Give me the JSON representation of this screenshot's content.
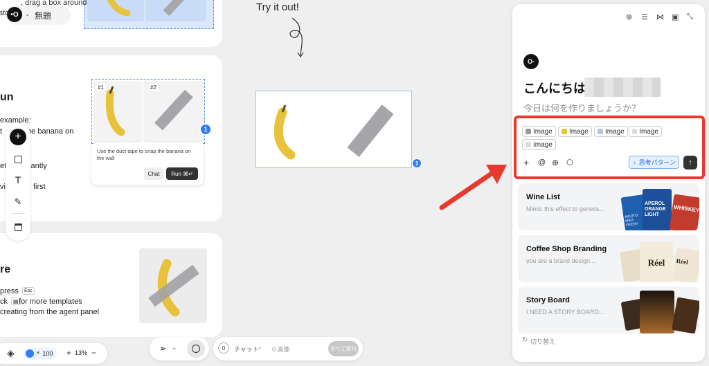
{
  "top_bar": {
    "hint_text": ", drag a box around",
    "hint_text2": "ato",
    "project_title": "無題"
  },
  "canvas": {
    "try_it_out": "Try it out!",
    "mid_card": {
      "heading": "un",
      "line1": "example:",
      "line2": "t",
      "line2b": "the banana on",
      "line3": "et",
      "line3b": "stantly",
      "line4": "vit",
      "line4b": "first",
      "image_labels": [
        "#1",
        "#2"
      ],
      "badge": "1",
      "prompt_text": "Use the duct tape to snap the banana on the wall",
      "chat_button": "Chat",
      "run_button": "Run ⌘↵"
    },
    "bot_card": {
      "heading": "re",
      "line1": "press",
      "esc": "Esc",
      "line2": "ck",
      "line2b": "for more templates",
      "line3": "creating from the agent panel"
    },
    "center_badge": "1"
  },
  "bottom_left": {
    "credits": "100",
    "zoom": "13%"
  },
  "bottom_center": {
    "count": "0",
    "chat_label": "チャット",
    "images_label": "0 画像",
    "run_all": "すべて実行"
  },
  "panel": {
    "greeting": "こんにちは",
    "subtitle": "今日は何を作りましょうか？",
    "chips": [
      "Image",
      "Image",
      "Image",
      "Image",
      "Image"
    ],
    "think_pattern": "思考パターン",
    "templates": [
      {
        "title": "Wine List",
        "desc": "Mimic this effect to genera...",
        "poster_text": "APEROL ORANGE LIGHT",
        "poster_text2": "WHISKEY",
        "poster_text3": "MOJITO MINT FRESH"
      },
      {
        "title": "Coffee Shop Branding",
        "desc": "you are a brand design...",
        "poster_text": "Réel",
        "poster_text2": "Réel"
      },
      {
        "title": "Story Board",
        "desc": "I NEED A STORY BOARD..."
      }
    ],
    "switch_label": "切り替え"
  },
  "colors": {
    "accent_red": "#e8392f",
    "selection_blue": "#4a90e2",
    "badge_blue": "#2f7cf6",
    "dark": "#1f1f1f"
  }
}
